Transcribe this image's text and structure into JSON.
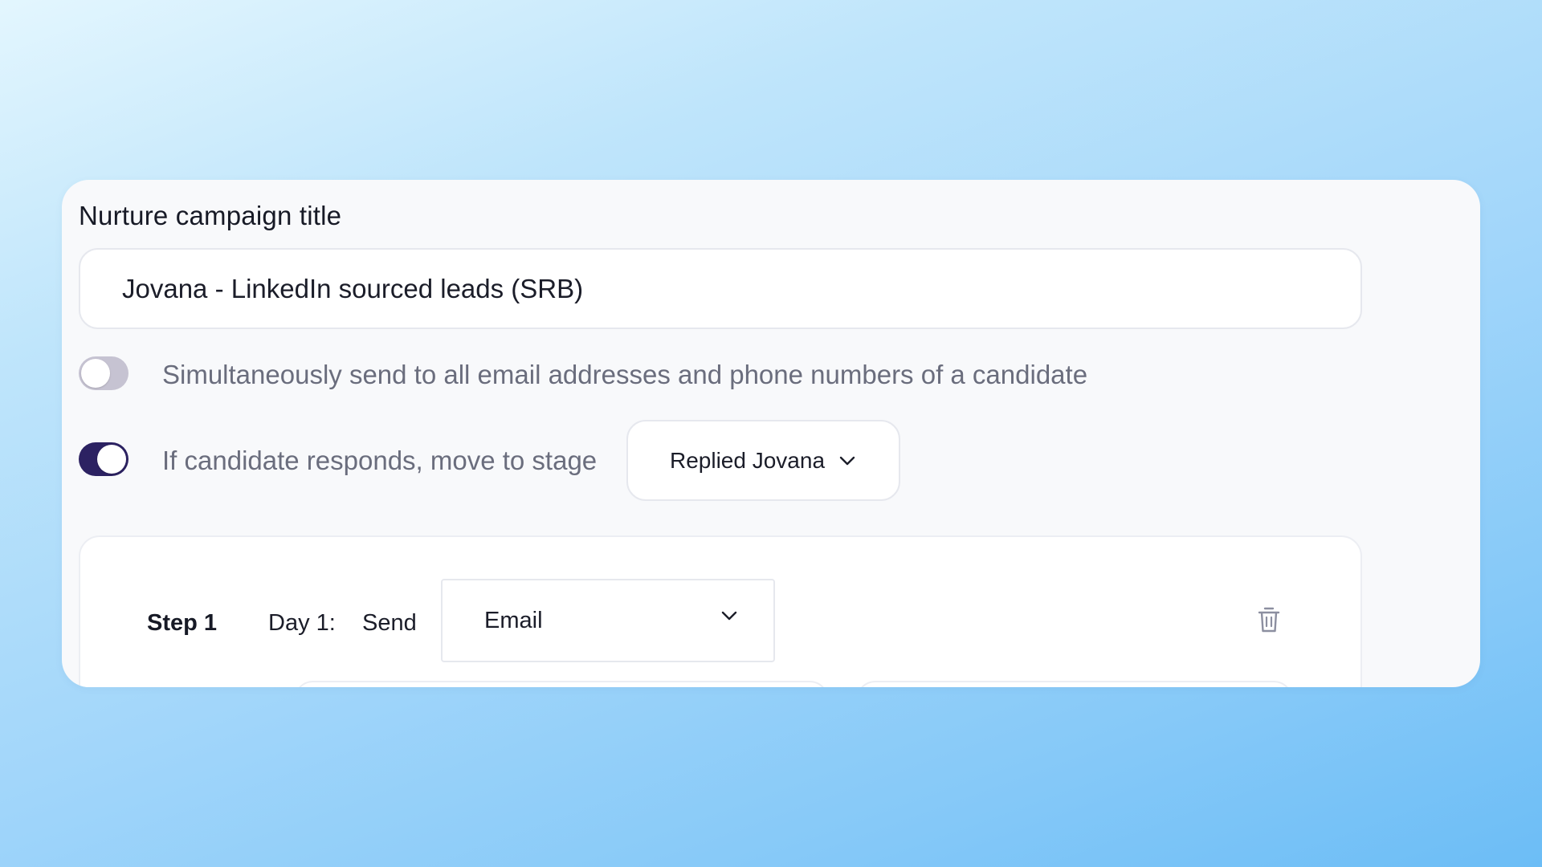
{
  "campaign": {
    "title_label": "Nurture campaign title",
    "title_value": "Jovana - LinkedIn sourced leads (SRB)"
  },
  "options": {
    "simultaneous_send": {
      "label": "Simultaneously send to all email addresses and phone numbers of a candidate",
      "enabled": false
    },
    "move_on_response": {
      "label": "If candidate responds, move to stage",
      "enabled": true,
      "stage_selected": "Replied Jovana"
    }
  },
  "steps": [
    {
      "label": "Step 1",
      "day": "Day 1:",
      "send_label": "Send",
      "channel": "Email"
    }
  ],
  "colors": {
    "toggle_on": "#2c2262",
    "toggle_off": "#c6c3d2",
    "card_background": "#f8f9fb"
  },
  "icons": {
    "dropdown": "chevron-down-icon",
    "delete": "trash-icon"
  }
}
